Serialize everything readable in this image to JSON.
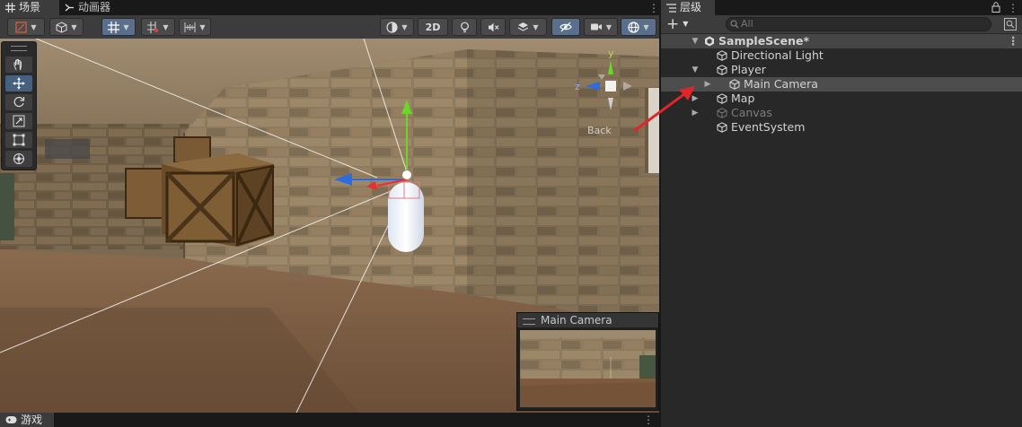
{
  "scene_panel": {
    "tabs": [
      {
        "label": "场景",
        "icon": "grid-icon",
        "active": true
      },
      {
        "label": "动画器",
        "icon": "animator-icon",
        "active": false
      }
    ],
    "toolbar": {
      "label_2d": "2D"
    },
    "tools": [
      "hand-tool-icon",
      "move-tool-icon",
      "rotate-tool-icon",
      "scale-tool-icon",
      "rect-tool-icon",
      "transform-tool-icon"
    ],
    "gizmo": {
      "axis_y": "y",
      "axis_z": "z",
      "view_label": "Back"
    },
    "camera_preview": {
      "title": "Main Camera"
    }
  },
  "game_tab": {
    "label": "游戏"
  },
  "hierarchy": {
    "tab_label": "层级",
    "add_label": "+",
    "search_placeholder": "All",
    "scene_name": "SampleScene*",
    "items": [
      {
        "label": "Directional Light",
        "depth": 1,
        "expand": "none",
        "selected": false,
        "dim": false
      },
      {
        "label": "Player",
        "depth": 1,
        "expand": "open",
        "selected": false,
        "dim": false
      },
      {
        "label": "Main Camera",
        "depth": 2,
        "expand": "closed",
        "selected": true,
        "dim": false
      },
      {
        "label": "Map",
        "depth": 1,
        "expand": "closed",
        "selected": false,
        "dim": false
      },
      {
        "label": "Canvas",
        "depth": 1,
        "expand": "closed",
        "selected": false,
        "dim": true
      },
      {
        "label": "EventSystem",
        "depth": 1,
        "expand": "none",
        "selected": false,
        "dim": false
      }
    ]
  },
  "colors": {
    "accent_blue": "#5a6f8b",
    "selection": "#4d4d4d",
    "annotation_arrow": "#e0262b",
    "axis_x": "#e8312e",
    "axis_y": "#6cd42b",
    "axis_z": "#2f6be0"
  }
}
